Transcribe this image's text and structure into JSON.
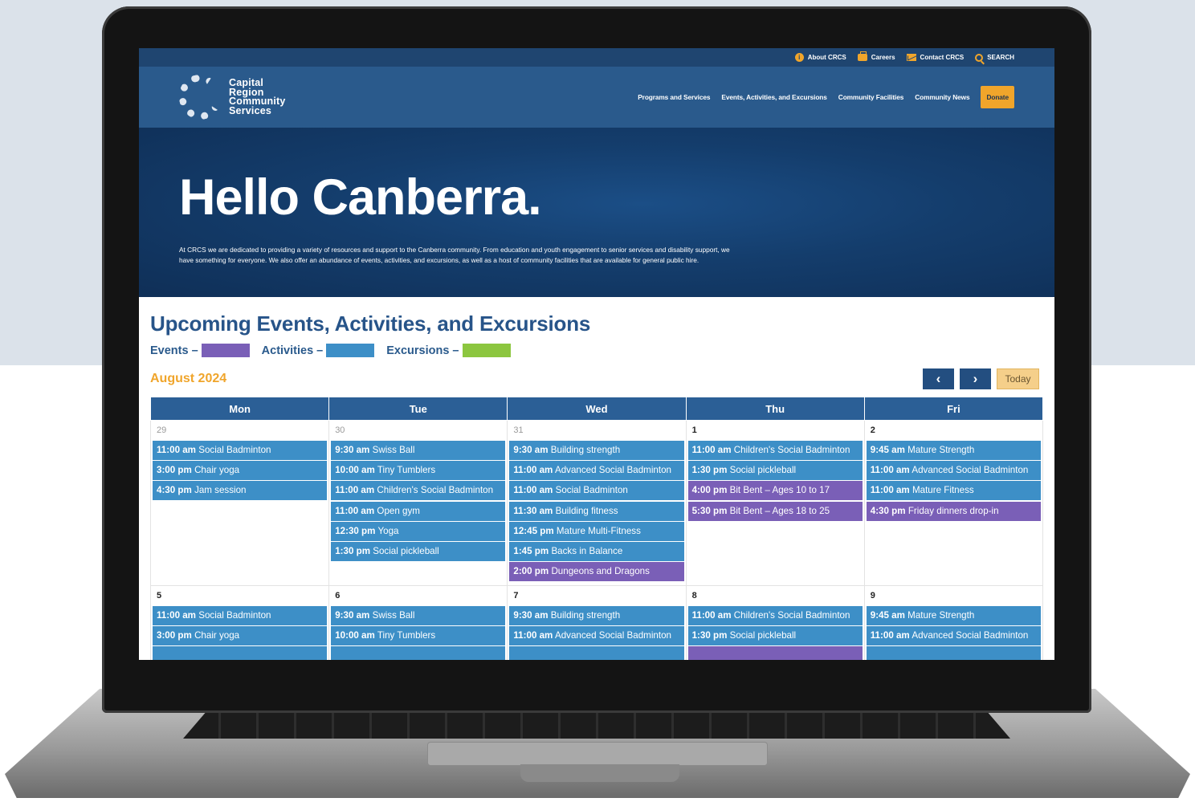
{
  "colors": {
    "event": "#7a5fb7",
    "activity": "#3d8fc7",
    "excursion": "#8cc63f",
    "accent": "#f0a52b",
    "navy": "#2a5a8c"
  },
  "topbar": {
    "links": [
      {
        "icon": "info-icon",
        "label": "About CRCS"
      },
      {
        "icon": "briefcase-icon",
        "label": "Careers"
      },
      {
        "icon": "mail-icon",
        "label": "Contact CRCS"
      },
      {
        "icon": "search-icon",
        "label": "SEARCH"
      }
    ]
  },
  "logo": {
    "icon": "crcs-logo-mark",
    "line1": "Capital",
    "line2": "Region",
    "line3": "Community",
    "line4": "Services"
  },
  "nav": {
    "items": [
      "Programs and Services",
      "Events, Activities, and Excursions",
      "Community Facilities",
      "Community News"
    ],
    "donate": "Donate"
  },
  "hero": {
    "title": "Hello Canberra.",
    "body": "At CRCS we are dedicated to providing a variety of resources and support to the Canberra community. From education and youth engagement to senior services and disability support, we have something for everyone. We also offer an abundance of events, activities, and excursions, as well as a host of community facilities that are available for general public hire."
  },
  "calendar": {
    "heading": "Upcoming Events, Activities, and Excursions",
    "legend": {
      "events": "Events –",
      "activities": "Activities –",
      "excursions": "Excursions –"
    },
    "month": "August 2024",
    "prev_icon": "‹",
    "next_icon": "›",
    "today": "Today",
    "days": [
      "Mon",
      "Tue",
      "Wed",
      "Thu",
      "Fri"
    ],
    "weeks": [
      [
        {
          "day": "29",
          "muted": true,
          "events": [
            {
              "time": "11:00 am",
              "title": "Social Badminton",
              "type": "activity"
            },
            {
              "time": "3:00 pm",
              "title": "Chair yoga",
              "type": "activity"
            },
            {
              "time": "4:30 pm",
              "title": "Jam session",
              "type": "activity"
            }
          ]
        },
        {
          "day": "30",
          "muted": true,
          "events": [
            {
              "time": "9:30 am",
              "title": "Swiss Ball",
              "type": "activity"
            },
            {
              "time": "10:00 am",
              "title": "Tiny Tumblers",
              "type": "activity"
            },
            {
              "time": "11:00 am",
              "title": "Children's Social Badminton",
              "type": "activity"
            },
            {
              "time": "11:00 am",
              "title": "Open gym",
              "type": "activity"
            },
            {
              "time": "12:30 pm",
              "title": "Yoga",
              "type": "activity"
            },
            {
              "time": "1:30 pm",
              "title": "Social pickleball",
              "type": "activity"
            }
          ]
        },
        {
          "day": "31",
          "muted": true,
          "events": [
            {
              "time": "9:30 am",
              "title": "Building strength",
              "type": "activity"
            },
            {
              "time": "11:00 am",
              "title": "Advanced Social Badminton",
              "type": "activity"
            },
            {
              "time": "11:00 am",
              "title": "Social Badminton",
              "type": "activity"
            },
            {
              "time": "11:30 am",
              "title": "Building fitness",
              "type": "activity"
            },
            {
              "time": "12:45 pm",
              "title": "Mature Multi-Fitness",
              "type": "activity"
            },
            {
              "time": "1:45 pm",
              "title": "Backs in Balance",
              "type": "activity"
            },
            {
              "time": "2:00 pm",
              "title": "Dungeons and Dragons",
              "type": "event"
            }
          ]
        },
        {
          "day": "1",
          "muted": false,
          "events": [
            {
              "time": "11:00 am",
              "title": "Children's Social Badminton",
              "type": "activity"
            },
            {
              "time": "1:30 pm",
              "title": "Social pickleball",
              "type": "activity"
            },
            {
              "time": "4:00 pm",
              "title": "Bit Bent – Ages 10 to 17",
              "type": "event"
            },
            {
              "time": "5:30 pm",
              "title": "Bit Bent – Ages 18 to 25",
              "type": "event"
            }
          ]
        },
        {
          "day": "2",
          "muted": false,
          "events": [
            {
              "time": "9:45 am",
              "title": "Mature Strength",
              "type": "activity"
            },
            {
              "time": "11:00 am",
              "title": "Advanced Social Badminton",
              "type": "activity"
            },
            {
              "time": "11:00 am",
              "title": "Mature Fitness",
              "type": "activity"
            },
            {
              "time": "4:30 pm",
              "title": "Friday dinners drop-in",
              "type": "event"
            }
          ]
        }
      ],
      [
        {
          "day": "5",
          "muted": false,
          "events": [
            {
              "time": "11:00 am",
              "title": "Social Badminton",
              "type": "activity"
            },
            {
              "time": "3:00 pm",
              "title": "Chair yoga",
              "type": "activity"
            },
            {
              "time": "",
              "title": "",
              "type": "activity"
            }
          ]
        },
        {
          "day": "6",
          "muted": false,
          "events": [
            {
              "time": "9:30 am",
              "title": "Swiss Ball",
              "type": "activity"
            },
            {
              "time": "10:00 am",
              "title": "Tiny Tumblers",
              "type": "activity"
            },
            {
              "time": "",
              "title": "",
              "type": "activity"
            }
          ]
        },
        {
          "day": "7",
          "muted": false,
          "events": [
            {
              "time": "9:30 am",
              "title": "Building strength",
              "type": "activity"
            },
            {
              "time": "11:00 am",
              "title": "Advanced Social Badminton",
              "type": "activity"
            },
            {
              "time": "",
              "title": "",
              "type": "activity"
            }
          ]
        },
        {
          "day": "8",
          "muted": false,
          "events": [
            {
              "time": "11:00 am",
              "title": "Children's Social Badminton",
              "type": "activity"
            },
            {
              "time": "1:30 pm",
              "title": "Social pickleball",
              "type": "activity"
            },
            {
              "time": "",
              "title": "",
              "type": "event"
            }
          ]
        },
        {
          "day": "9",
          "muted": false,
          "events": [
            {
              "time": "9:45 am",
              "title": "Mature Strength",
              "type": "activity"
            },
            {
              "time": "11:00 am",
              "title": "Advanced Social Badminton",
              "type": "activity"
            },
            {
              "time": "",
              "title": "",
              "type": "activity"
            }
          ]
        }
      ]
    ]
  }
}
